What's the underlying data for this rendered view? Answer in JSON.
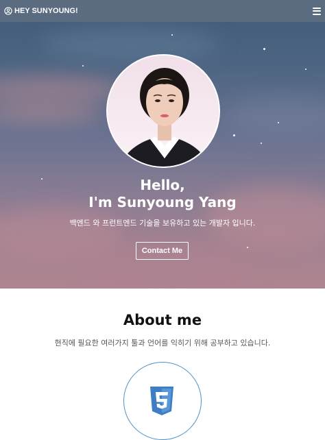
{
  "nav": {
    "brand": "HEY SUNYOUNG!",
    "brand_icon": "user-circle-icon",
    "menu_icon": "hamburger-menu-icon"
  },
  "hero": {
    "title_line1": "Hello,",
    "title_line2": "I'm Sunyoung Yang",
    "subtitle": "백엔드 와 프런트엔드 기술을 보유하고 있는 개발자 입니다.",
    "contact_button": "Contact Me"
  },
  "about": {
    "title": "About me",
    "subtitle": "현직에 필요한 여러가지 툴과 언어를 익히기 위해 공부하고 있습니다.",
    "skills": [
      {
        "icon": "html5-icon"
      }
    ]
  },
  "colors": {
    "nav_bg": "#5b6b80",
    "skill_ring": "#4e8fc9",
    "html5_orange": "#3f7dc4"
  }
}
